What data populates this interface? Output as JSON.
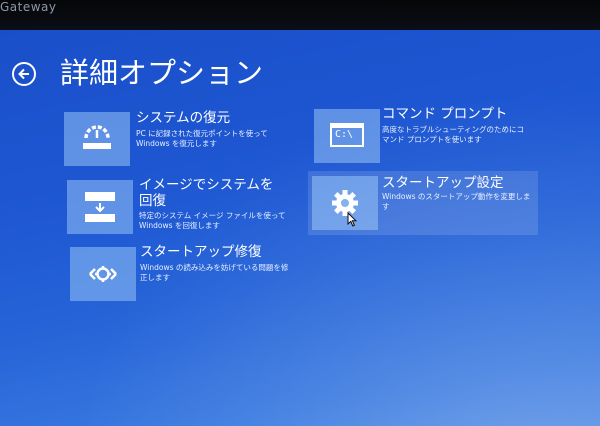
{
  "bezel": {
    "brand": "Gateway"
  },
  "header": {
    "title": "詳細オプション",
    "back_icon": "arrow-left-circle-icon"
  },
  "options": [
    {
      "id": "system-restore",
      "title": "システムの復元",
      "description": "PC に記録された復元ポイントを使って Windows を復元します",
      "icon": "restore-icon"
    },
    {
      "id": "system-image-recovery",
      "title": "イメージでシステムを回復",
      "description": "特定のシステム イメージ ファイルを使って Windows を回復します",
      "icon": "image-recovery-icon"
    },
    {
      "id": "startup-repair",
      "title": "スタートアップ修復",
      "description": "Windows の読み込みを妨げている問題を修正します",
      "icon": "startup-repair-icon"
    },
    {
      "id": "command-prompt",
      "title": "コマンド プロンプト",
      "description": "高度なトラブルシューティングのためにコマンド プロンプトを使います",
      "icon": "command-prompt-icon",
      "icon_text": "C:\\"
    },
    {
      "id": "startup-settings",
      "title": "スタートアップ設定",
      "description": "Windows のスタートアップ動作を変更します",
      "icon": "gear-icon",
      "selected": true
    }
  ],
  "colors": {
    "background": "#1e57d2",
    "tile_icon_bg": "#7fb0ee",
    "text": "#ffffff"
  }
}
